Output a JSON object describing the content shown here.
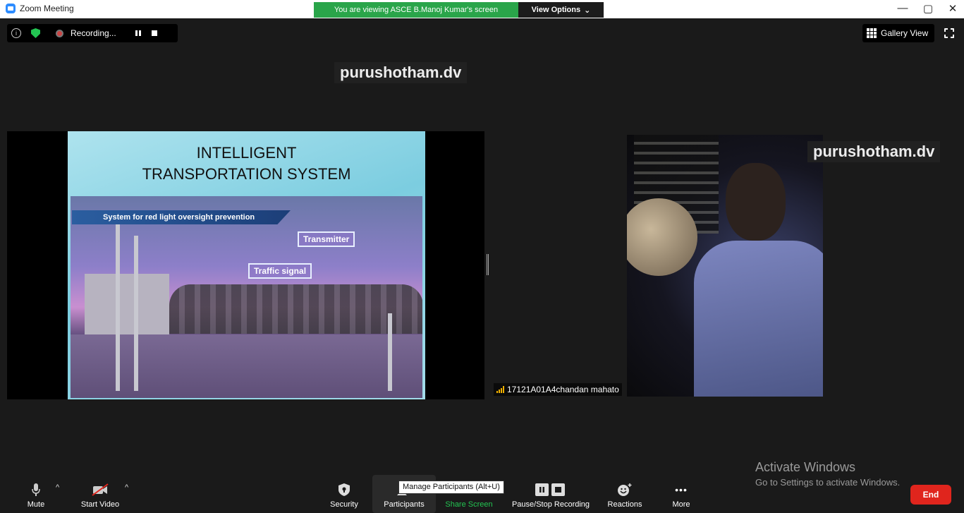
{
  "window": {
    "title": "Zoom Meeting",
    "banner": "You are viewing ASCE B.Manoj Kumar's screen",
    "view_options": "View Options",
    "view_options_caret": "⌄",
    "minimize": "—",
    "maximize": "▢",
    "close": "✕"
  },
  "status": {
    "info_glyph": "i",
    "recording_label": "Recording...",
    "gallery_view": "Gallery View"
  },
  "watermarks": {
    "top": "purushotham.dv",
    "right": "purushotham.dv"
  },
  "slide": {
    "title_line1": "INTELLIGENT",
    "title_line2": "TRANSPORTATION   SYSTEM",
    "ribbon": "System for red light oversight prevention",
    "callout_transmitter": "Transmitter",
    "callout_traffic": "Traffic signal"
  },
  "participant": {
    "name": "17121A01A4chandan mahato"
  },
  "toolbar": {
    "mute": "Mute",
    "start_video": "Start Video",
    "security": "Security",
    "participants": "Participants",
    "share_screen": "Share Screen",
    "pause_stop_recording": "Pause/Stop Recording",
    "reactions": "Reactions",
    "more": "More",
    "more_glyph": "•••",
    "caret": "^",
    "end": "End",
    "share_screen_color": "#23c552"
  },
  "tooltip": "Manage Participants (Alt+U)",
  "activation": {
    "line1": "Activate Windows",
    "line2": "Go to Settings to activate Windows."
  },
  "colors": {
    "banner_green": "#2aa54a",
    "end_red": "#e0251d",
    "zoom_blue": "#2d8cff"
  }
}
